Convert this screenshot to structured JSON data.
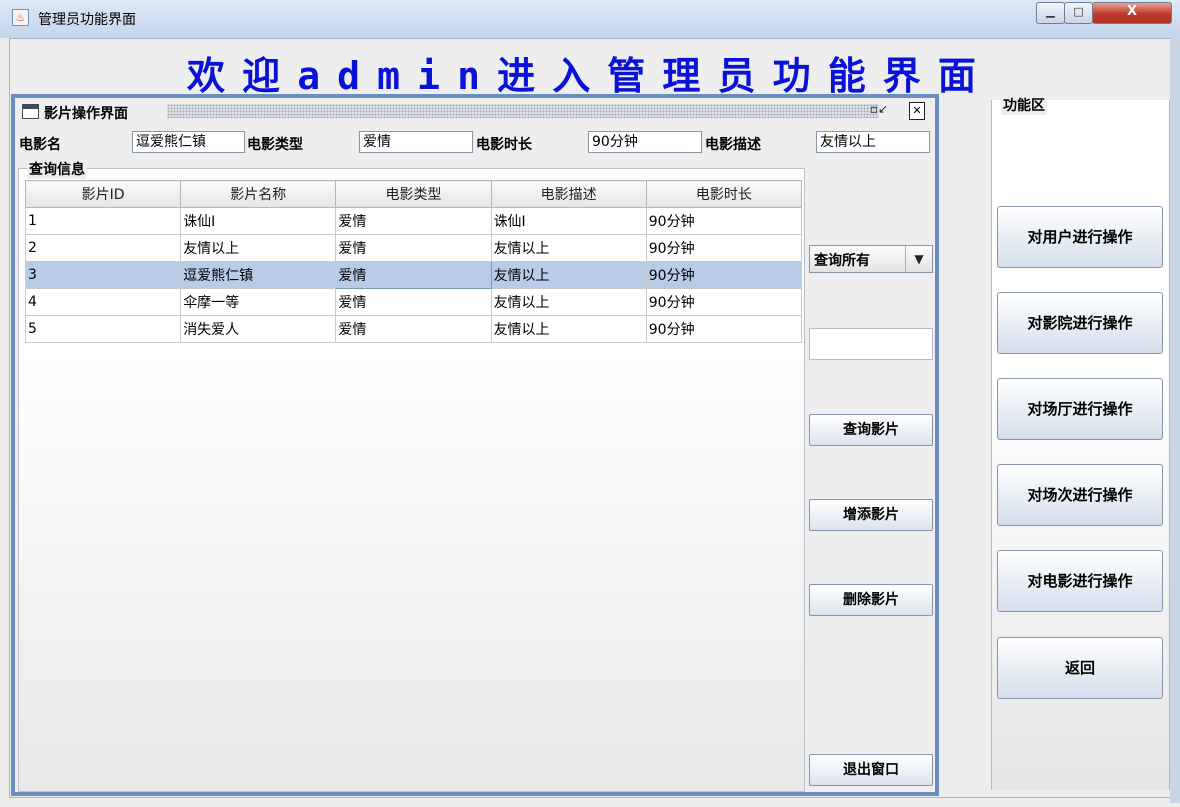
{
  "window": {
    "title": "管理员功能界面",
    "controls": {
      "minimize": "▁",
      "maximize": "□",
      "close": "X"
    }
  },
  "welcome": "欢迎admin进入管理员功能界面",
  "frame": {
    "title": "影片操作界面",
    "minimize_icon": "restore-icon",
    "close_icon": "close-icon"
  },
  "form": {
    "name_label": "电影名",
    "name_value": "逗爱熊仁镇",
    "type_label": "电影类型",
    "type_value": "爱情",
    "duration_label": "电影时长",
    "duration_value": "90分钟",
    "desc_label": "电影描述",
    "desc_value": "友情以上"
  },
  "query": {
    "legend": "查询信息",
    "columns": [
      "影片ID",
      "影片名称",
      "电影类型",
      "电影描述",
      "电影时长"
    ],
    "rows": [
      [
        "1",
        "诛仙I",
        "爱情",
        "诛仙I",
        "90分钟"
      ],
      [
        "2",
        "友情以上",
        "爱情",
        "友情以上",
        "90分钟"
      ],
      [
        "3",
        "逗爱熊仁镇",
        "爱情",
        "友情以上",
        "90分钟"
      ],
      [
        "4",
        "伞摩一等",
        "爱情",
        "友情以上",
        "90分钟"
      ],
      [
        "5",
        "消失爱人",
        "爱情",
        "友情以上",
        "90分钟"
      ]
    ],
    "selected_row": 3
  },
  "side": {
    "combo_value": "查询所有",
    "search_value": "",
    "query_button": "查询影片",
    "add_button": "增添影片",
    "delete_button": "删除影片",
    "exit_button": "退出窗口"
  },
  "function_area": {
    "title": "功能区",
    "buttons": [
      "对用户进行操作",
      "对影院进行操作",
      "对场厅进行操作",
      "对场次进行操作",
      "对电影进行操作",
      "返回"
    ]
  },
  "colors": {
    "heading": "#0a12d8",
    "frame_border": "#6a8ec2",
    "selected_row": "#b7cce6"
  }
}
